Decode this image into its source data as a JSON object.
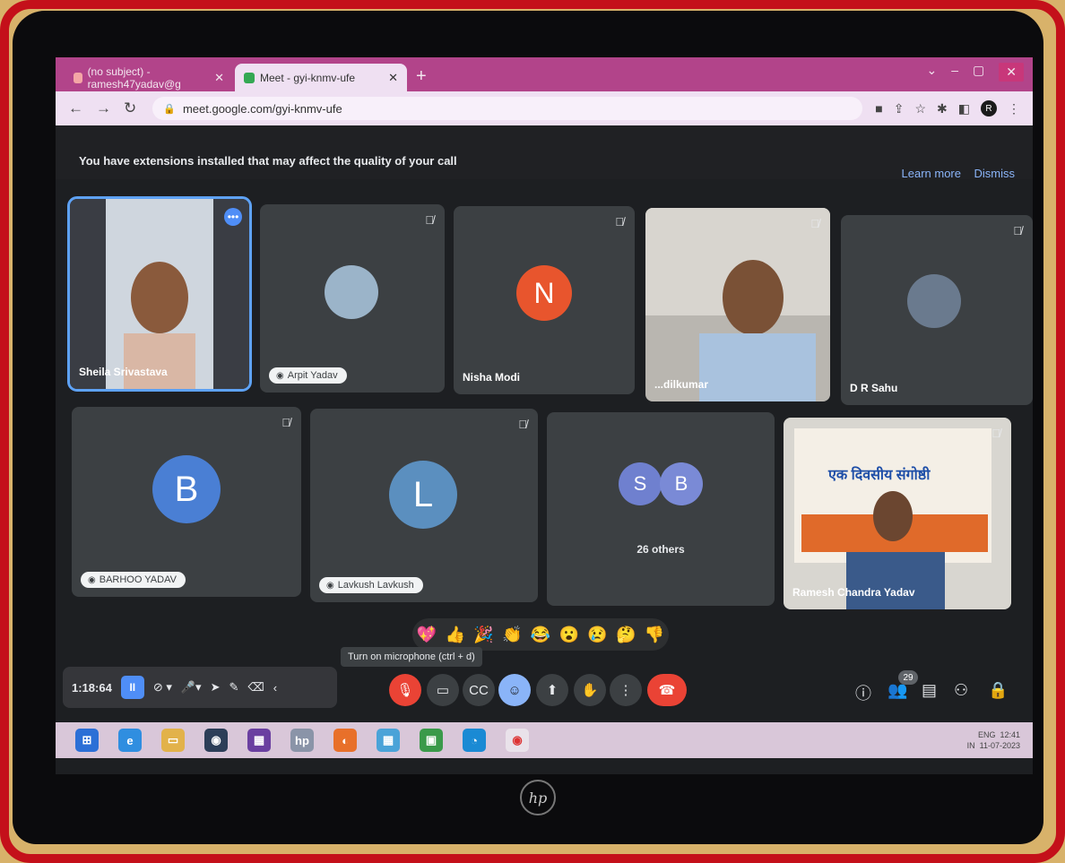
{
  "browser": {
    "tabs": [
      {
        "title": "(no subject) - ramesh47yadav@g"
      },
      {
        "title": "Meet - gyi-knmv-ufe"
      }
    ],
    "new_tab": "+",
    "url": "meet.google.com/gyi-knmv-ufe",
    "profile_initial": "R"
  },
  "meet": {
    "warning": "You have extensions installed that may affect the quality of your call",
    "learn_more": "Learn more",
    "dismiss": "Dismiss",
    "participants": [
      {
        "name": "Sheila Srivastava",
        "type": "video",
        "selected": true
      },
      {
        "name": "Arpit Yadav",
        "type": "photo",
        "pill": true
      },
      {
        "name": "Nisha Modi",
        "type": "letter",
        "letter": "N",
        "color": "#e8552d"
      },
      {
        "name": "...dilkumar",
        "type": "video"
      },
      {
        "name": "D R Sahu",
        "type": "photo"
      },
      {
        "name": "BARHOO YADAV",
        "type": "letter",
        "letter": "B",
        "color": "#4a7fd4",
        "pill": true
      },
      {
        "name": "Lavkush Lavkush",
        "type": "letter",
        "letter": "L",
        "color": "#5b8fbf",
        "pill": true
      },
      {
        "name": "26 others",
        "type": "group",
        "letters": [
          "S",
          "B"
        ]
      },
      {
        "name": "Ramesh Chandra Yadav",
        "type": "video"
      }
    ],
    "banner_title": "एक दिवसीय संगोष्ठी",
    "reactions": [
      "💖",
      "👍",
      "🎉",
      "👏",
      "😂",
      "😮",
      "😢",
      "🤔",
      "👎"
    ],
    "tooltip": "Turn on microphone (ctrl + d)",
    "annotation": {
      "timer": "1:18:64"
    },
    "participant_count": "29",
    "colors": {
      "end_call": "#ea4335",
      "mic_off": "#ea4335",
      "accent": "#8ab4f8"
    }
  },
  "taskbar": {
    "lang": "ENG",
    "region": "IN",
    "time": "12:41",
    "date": "11-07-2023"
  },
  "hp_logo": "hp"
}
